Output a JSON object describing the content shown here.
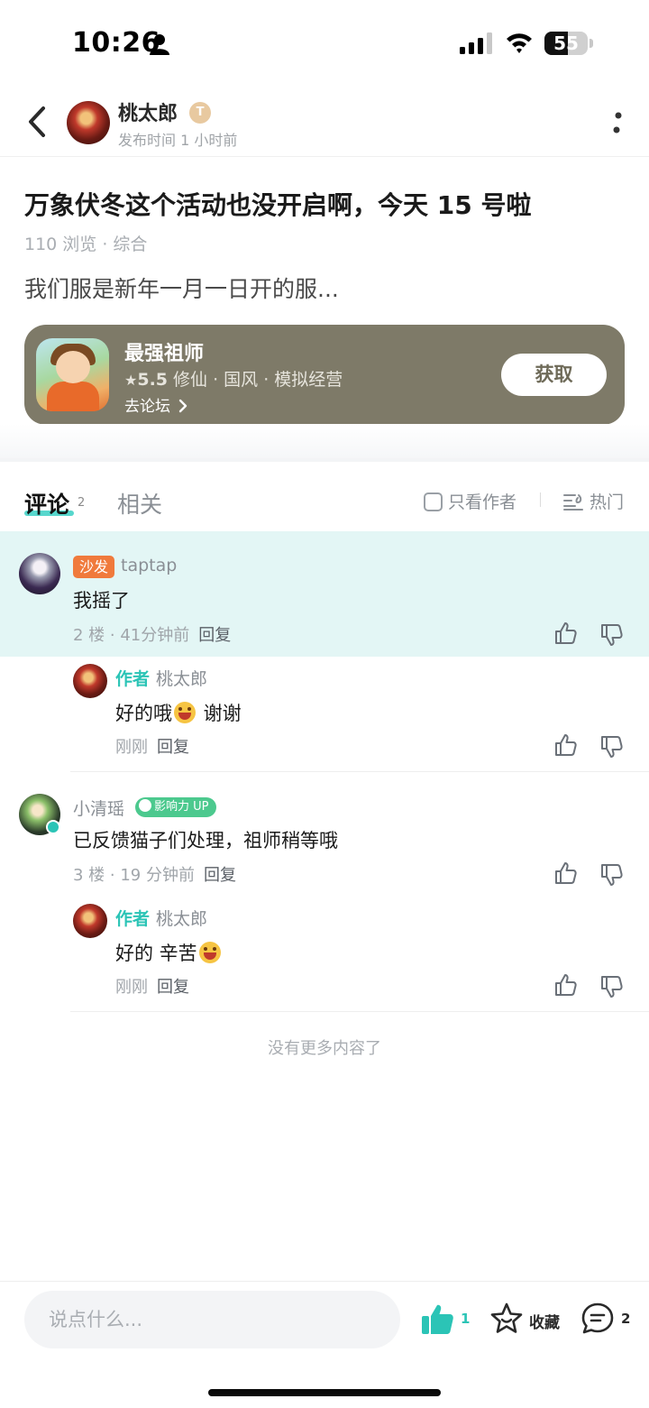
{
  "status_bar": {
    "time": "10:26",
    "battery": "55",
    "battery_level": 0.55
  },
  "header": {
    "author_name": "桃太郎",
    "author_badge": "T",
    "post_time": "发布时间 1 小时前"
  },
  "post": {
    "title": "万象伏冬这个活动也没开启啊，今天 15 号啦",
    "meta": "110 浏览 · 综合",
    "body": "我们服是新年一月一日开的服..."
  },
  "app_card": {
    "name": "最强祖师",
    "rating": "5.5",
    "tags": " 修仙 · 国风 · 模拟经营",
    "forum_link": "去论坛",
    "get_label": "获取"
  },
  "tabs": {
    "comments_label": "评论",
    "comments_count": "2",
    "related_label": "相关",
    "author_only_label": "只看作者",
    "sort_label": "热门"
  },
  "comments": [
    {
      "badge": "沙发",
      "user": "taptap",
      "text": "我摇了",
      "meta": "2 楼 · 41分钟前",
      "reply_label": "回复",
      "reply": {
        "tag": "作者",
        "user": "桃太郎",
        "text_before": "好的哦",
        "text_after": " 谢谢",
        "meta": "刚刚",
        "reply_label": "回复"
      }
    },
    {
      "user": "小清瑶",
      "badge": "影响力 UP",
      "text": "已反馈猫子们处理，祖师稍等哦",
      "meta": "3 楼 · 19 分钟前",
      "reply_label": "回复",
      "reply": {
        "tag": "作者",
        "user": "桃太郎",
        "text_before": "好的 辛苦",
        "text_after": "",
        "meta": "刚刚",
        "reply_label": "回复"
      }
    }
  ],
  "no_more": "没有更多内容了",
  "bottom_bar": {
    "input_placeholder": "说点什么...",
    "like_count": "1",
    "favorite_label": "收藏",
    "comment_count": "2"
  },
  "colors": {
    "accent": "#2bc4b6",
    "card_bg": "#7e7a68",
    "sofa_badge": "#f07a3c",
    "highlight_bg": "#e3f6f5"
  }
}
